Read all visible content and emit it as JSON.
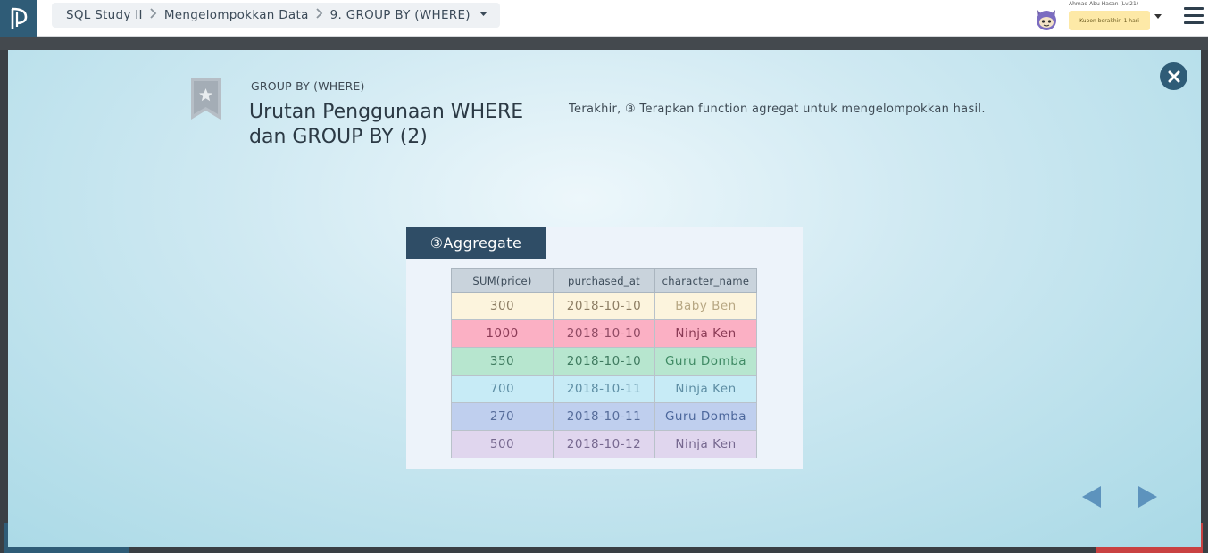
{
  "header": {
    "breadcrumb": [
      "SQL Study II",
      "Mengelompokkan Data",
      "9. GROUP BY (WHERE)"
    ],
    "user_name": "Ahmad Abu Hasan (Lv.21)",
    "coupon_text": "Kupon berakhir: 1 hari"
  },
  "slide": {
    "subtitle": "GROUP BY (WHERE)",
    "title": "Urutan Penggunaan WHERE dan GROUP BY (2)",
    "description": "Terakhir, ③ Terapkan function agregat untuk mengelompokkan hasil.",
    "illustration": {
      "tag": "③Aggregate",
      "columns": [
        "SUM(price)",
        "purchased_at",
        "character_name"
      ],
      "rows": [
        [
          "300",
          "2018-10-10",
          "Baby Ben"
        ],
        [
          "1000",
          "2018-10-10",
          "Ninja Ken"
        ],
        [
          "350",
          "2018-10-10",
          "Guru Domba"
        ],
        [
          "700",
          "2018-10-11",
          "Ninja Ken"
        ],
        [
          "270",
          "2018-10-11",
          "Guru Domba"
        ],
        [
          "500",
          "2018-10-12",
          "Ninja Ken"
        ]
      ]
    }
  },
  "colors": {
    "brand_dark": "#2f5c77",
    "tag_bg": "#2f4d66",
    "nav_arrow": "#5d93bd"
  },
  "icons": [
    "logo-icon",
    "chevron-right-icon",
    "caret-down-icon",
    "avatar-icon",
    "menu-icon",
    "close-icon",
    "bookmark-star-icon",
    "arrow-left-icon",
    "arrow-right-icon"
  ]
}
